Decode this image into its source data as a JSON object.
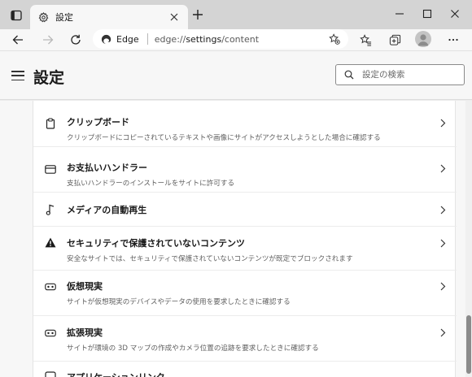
{
  "tab": {
    "title": "設定",
    "icon": "gear-icon"
  },
  "toolbar": {
    "site_label": "Edge",
    "url_prefix": "edge://",
    "url_main": "settings",
    "url_suffix": "/content"
  },
  "header": {
    "title": "設定",
    "search_placeholder": "設定の検索"
  },
  "settings_items": [
    {
      "title": "クリップボード",
      "description": "クリップボードにコピーされているテキストや画像にサイトがアクセスしようとした場合に確認する",
      "icon": "clipboard-icon"
    },
    {
      "title": "お支払いハンドラー",
      "description": "支払いハンドラーのインストールをサイトに許可する",
      "icon": "credit-card-icon"
    },
    {
      "title": "メディアの自動再生",
      "description": "",
      "icon": "music-note-icon"
    },
    {
      "title": "セキュリティで保護されていないコンテンツ",
      "description": "安全なサイトでは、セキュリティで保護されていないコンテンツが既定でブロックされます",
      "icon": "warning-icon"
    },
    {
      "title": "仮想現実",
      "description": "サイトが仮想現実のデバイスやデータの使用を要求したときに確認する",
      "icon": "vr-headset-icon"
    },
    {
      "title": "拡張現実",
      "description": "サイトが環境の 3D マップの作成やカメラ位置の追跡を要求したときに確認する",
      "icon": "ar-headset-icon"
    },
    {
      "title": "アプリケーションリンク",
      "description": "",
      "icon": "app-link-icon"
    }
  ],
  "colors": {
    "titlebar": "#d4d4d4",
    "surface": "#f7f7f7",
    "card": "#ffffff"
  }
}
